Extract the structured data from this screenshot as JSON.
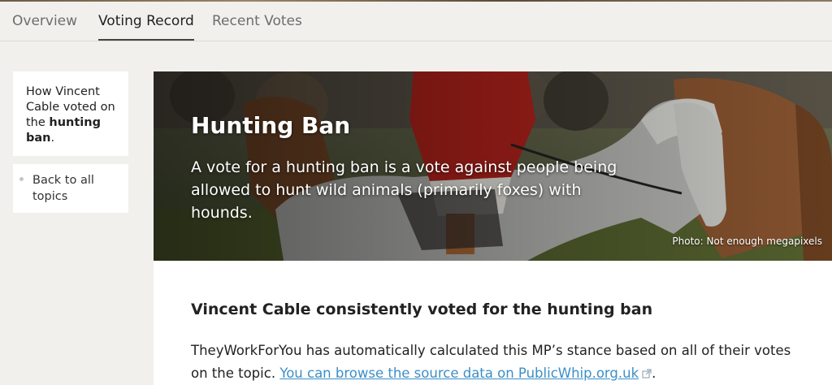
{
  "tabs": [
    {
      "label": "Overview",
      "active": false
    },
    {
      "label": "Voting Record",
      "active": true
    },
    {
      "label": "Recent Votes",
      "active": false
    }
  ],
  "sidebar": {
    "intro_prefix": "How Vincent Cable voted on the ",
    "intro_topic": "hunting ban",
    "intro_suffix": ".",
    "back_label": "Back to all topics"
  },
  "hero": {
    "title": "Hunting Ban",
    "description": "A vote for a hunting ban is a vote against people being allowed to hunt wild animals (primarily foxes) with hounds.",
    "photo_credit": "Photo: Not enough megapixels"
  },
  "content": {
    "summary_prefix": "Vincent Cable consistently voted for the ",
    "summary_topic": "hunting ban",
    "explain_text": "TheyWorkForYou has automatically calculated this MP’s stance based on all of their votes on the topic. ",
    "source_link": "You can browse the source data on PublicWhip.org.uk",
    "explain_end": "."
  },
  "colors": {
    "background": "#f2f0ec",
    "link": "#3b8fc7",
    "active_tab_underline": "#444444"
  },
  "icons": [
    "external-link-icon",
    "bullet-icon"
  ]
}
